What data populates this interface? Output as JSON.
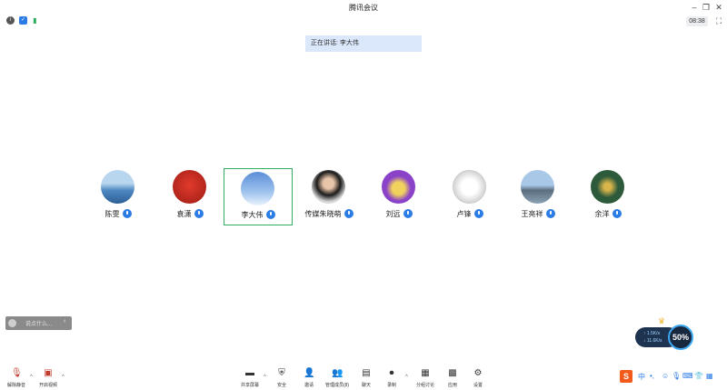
{
  "window": {
    "title": "腾讯会议"
  },
  "infobar": {
    "clock": "08:38"
  },
  "speaking": {
    "text": "正在讲话: 李大伟"
  },
  "participants": [
    {
      "name": "陈雯"
    },
    {
      "name": "袁潇"
    },
    {
      "name": "李大伟"
    },
    {
      "name": "传媒朱晓萌"
    },
    {
      "name": "刘远"
    },
    {
      "name": "卢锋"
    },
    {
      "name": "王亮祥"
    },
    {
      "name": "余洋"
    }
  ],
  "chat": {
    "placeholder": "说点什么..."
  },
  "network": {
    "up": "↑ 1.5K/s",
    "down": "↓ 11.6K/s",
    "percent": "50%"
  },
  "toolbar": {
    "unmute": "解除静音",
    "start_video": "开启视频",
    "share_screen": "共享屏幕",
    "security": "安全",
    "invite": "邀请",
    "manage_members": "管理成员(8)",
    "chat": "聊天",
    "record": "录制",
    "breakout": "分组讨论",
    "apps": "应用",
    "settings": "设置"
  },
  "ime": {
    "lang": "中"
  },
  "colors": {
    "active_border": "#2fae5f",
    "mic_blue": "#2c7ce6",
    "speaking_bg": "#dbe8fb"
  }
}
